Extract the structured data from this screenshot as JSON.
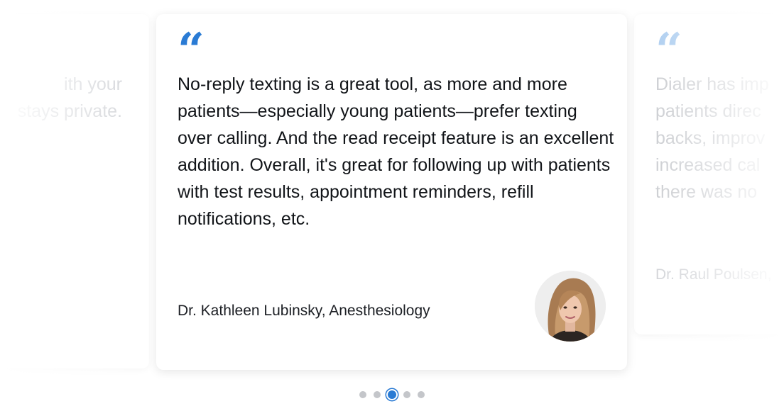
{
  "carousel": {
    "prev": {
      "quote_lines": "ith your\nstays private."
    },
    "current": {
      "quote_mark": "“",
      "quote": "No-reply texting is a great tool, as more and more patients—especially young patients—prefer texting over calling. And the read receipt feature is an excellent addition. Overall, it's great for following up with patients with test results, appointment reminders, refill notifications, etc.",
      "author": "Dr. Kathleen Lubinsky, Anesthesiology",
      "avatar_alt": "Dr. Kathleen Lubinsky"
    },
    "next": {
      "quote_mark": "“",
      "quote_lines": "Dialer has imp\npatients direc\nbacks, improv\nincreased cal\nthere was no ",
      "author": "Dr. Raul Poulsen,"
    },
    "dots": [
      {
        "active": false
      },
      {
        "active": false
      },
      {
        "active": true
      },
      {
        "active": false
      },
      {
        "active": false
      }
    ],
    "active_index": 2,
    "colors": {
      "accent": "#2a7bd4",
      "accent_faded": "#a9cbef",
      "dot_inactive": "#c4c6ca",
      "text_primary": "#111418",
      "text_faded": "#c9cbcf"
    }
  }
}
